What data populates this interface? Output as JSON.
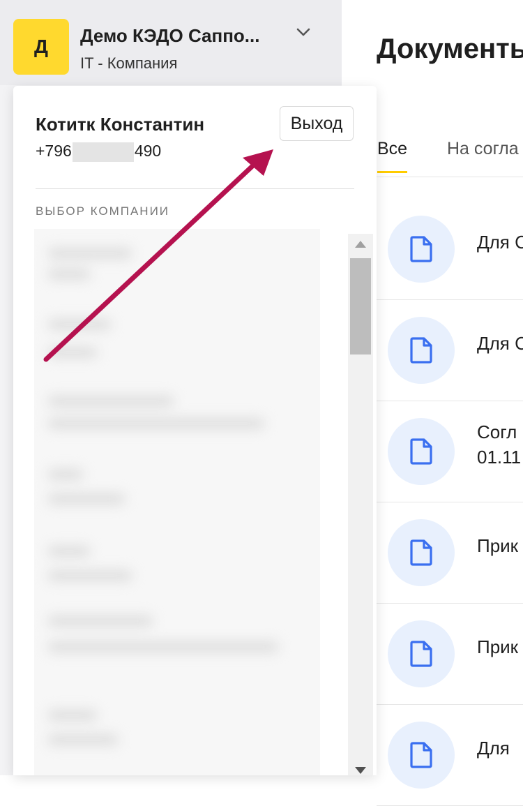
{
  "company_switcher": {
    "avatar_letter": "Д",
    "name": "Демо КЭДО Саппо...",
    "type": "IT - Компания",
    "chevron_icon": "chevron-down-icon"
  },
  "main": {
    "title": "Документы",
    "tabs": [
      {
        "label": "Все",
        "active": true
      },
      {
        "label": "На согла"
      }
    ],
    "documents": [
      {
        "title": "Для С",
        "icon": "document-icon"
      },
      {
        "title": "Для С",
        "icon": "document-icon"
      },
      {
        "title": "Согл\n01.11",
        "icon": "document-icon"
      },
      {
        "title": "Прик",
        "icon": "document-icon"
      },
      {
        "title": "Прик",
        "icon": "document-icon"
      },
      {
        "title": "Для",
        "icon": "document-icon"
      }
    ]
  },
  "popup": {
    "user_name": "Котитк Константин",
    "phone_prefix": "+796",
    "phone_suffix": "490",
    "logout_label": "Выход",
    "section_label": "ВЫБОР КОМПАНИИ"
  },
  "colors": {
    "accent_yellow": "#ffd92e",
    "tab_underline": "#ffcc00",
    "doc_icon_blue": "#3a6ff0",
    "doc_icon_bg": "#e8f0fd",
    "annotation_arrow": "#b5124f"
  }
}
